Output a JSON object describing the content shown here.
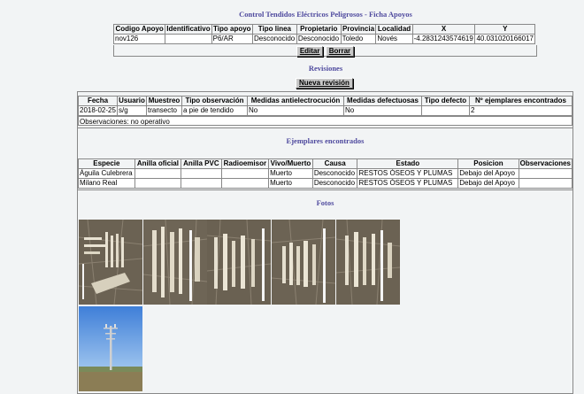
{
  "page_title": "Control Tendidos Eléctricos Peligrosos - Ficha Apoyos",
  "apoyo": {
    "headers": [
      "Codigo Apoyo",
      "Identificativo",
      "Tipo apoyo",
      "Tipo linea",
      "Propietario",
      "Provincia",
      "Localidad",
      "X",
      "Y"
    ],
    "row": [
      "nov126",
      "",
      "P6/AR",
      "Desconocido",
      "Desconocido",
      "Toledo",
      "Novés",
      "-4.2831243574619",
      "40.031020166017"
    ],
    "edit_label": "Editar",
    "delete_label": "Borrar"
  },
  "revisiones": {
    "title": "Revisiones",
    "new_label": "Nueva revisión",
    "headers": [
      "Fecha",
      "Usuario",
      "Muestreo",
      "Tipo observación",
      "Medidas antielectrocución",
      "Medidas defectuosas",
      "Tipo defecto",
      "Nº ejemplares encontrados"
    ],
    "row": [
      "2018-02-25",
      "s/g",
      "transecto",
      "a pie de tendido",
      "No",
      "No",
      "",
      "2"
    ],
    "observaciones": "Observaciones: no operativo"
  },
  "ejemplares": {
    "title": "Ejemplares encontrados",
    "headers": [
      "Especie",
      "Anilla oficial",
      "Anilla PVC",
      "Radioemisor",
      "Vivo/Muerto",
      "Causa",
      "Estado",
      "Posicion",
      "Observaciones"
    ],
    "rows": [
      [
        "Águila Culebrera",
        "",
        "",
        "",
        "Muerto",
        "Desconocido",
        "RESTOS ÓSEOS Y PLUMAS",
        "Debajo del Apoyo",
        ""
      ],
      [
        "Milano Real",
        "",
        "",
        "",
        "Muerto",
        "Desconocido",
        "RESTOS ÓSEOS Y PLUMAS",
        "Debajo del Apoyo",
        ""
      ]
    ]
  },
  "fotos": {
    "title": "Fotos",
    "items": [
      "bones-photo",
      "bones-photo",
      "bones-photo",
      "bones-photo",
      "bones-photo",
      "pylon-photo"
    ]
  }
}
